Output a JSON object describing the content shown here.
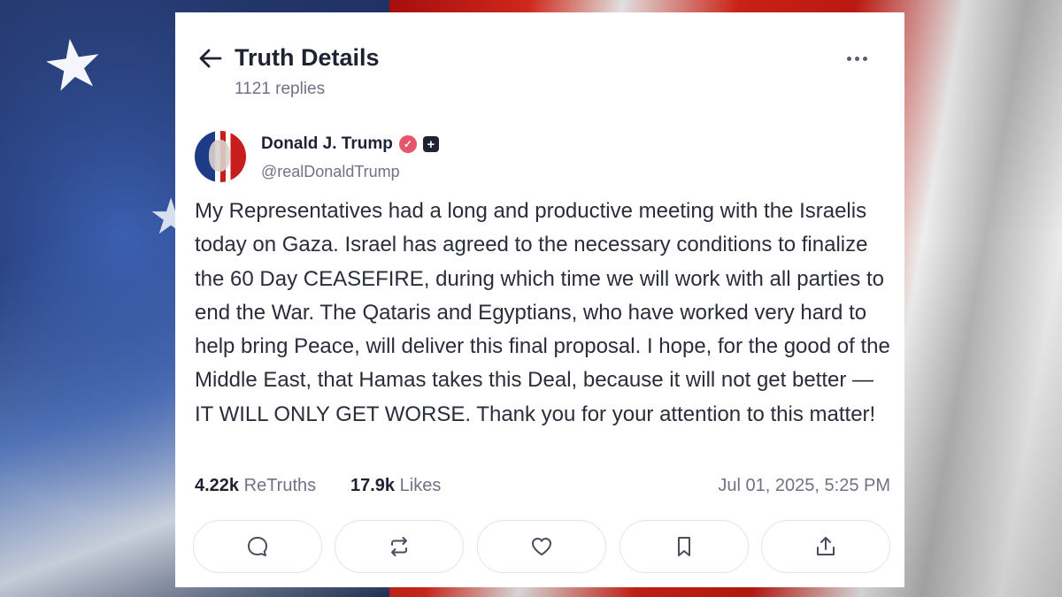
{
  "header": {
    "title": "Truth Details",
    "replies": "1121 replies"
  },
  "post": {
    "author_name": "Donald J. Trump",
    "author_handle": "@realDonaldTrump",
    "verified_color": "#e6566b",
    "text": "My Representatives had a long and productive meeting with the Israelis today on Gaza. Israel has agreed to the necessary conditions to finalize the 60 Day CEASEFIRE, during which time we will work with all parties to end the War. The Qataris and Egyptians, who have worked very hard to help bring Peace, will deliver this final proposal. I hope, for the good of the Middle East, that Hamas takes this Deal, because it will not get better — IT WILL ONLY GET WORSE. Thank you for your attention to this matter!",
    "retruths_count": "4.22k",
    "retruths_label": "ReTruths",
    "likes_count": "17.9k",
    "likes_label": "Likes",
    "timestamp": "Jul 01, 2025, 5:25 PM"
  },
  "actions": [
    "reply-icon",
    "retruth-icon",
    "like-icon",
    "bookmark-icon",
    "share-icon"
  ]
}
